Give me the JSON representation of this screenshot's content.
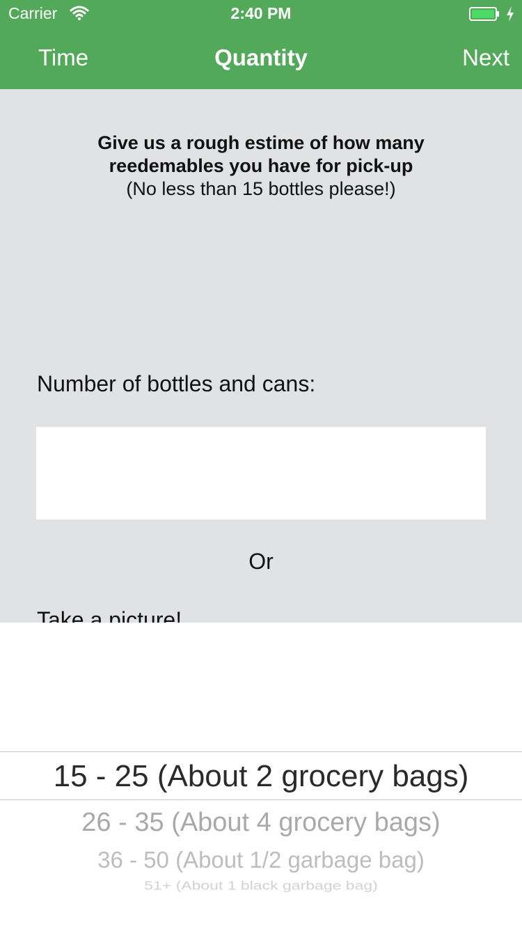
{
  "status_bar": {
    "carrier": "Carrier",
    "time": "2:40 PM",
    "battery_color": "#4cd964"
  },
  "nav": {
    "back_label": "Time",
    "title": "Quantity",
    "next_label": "Next",
    "background_color": "#52a95a"
  },
  "intro": {
    "line1": "Give us a rough estime of how many",
    "line2": "reedemables you have for pick-up",
    "note": "(No less than 15 bottles please!)"
  },
  "form": {
    "count_label": "Number of bottles and cans:",
    "count_value": "",
    "or_text": "Or",
    "picture_label": "Take a picture!"
  },
  "picker": {
    "selected": "15 - 25 (About 2 grocery bags)",
    "options": [
      "15 - 25 (About 2 grocery bags)",
      "26 - 35 (About 4 grocery bags)",
      "36 - 50 (About 1/2 garbage bag)",
      "51+ (About 1 black garbage bag)"
    ]
  }
}
